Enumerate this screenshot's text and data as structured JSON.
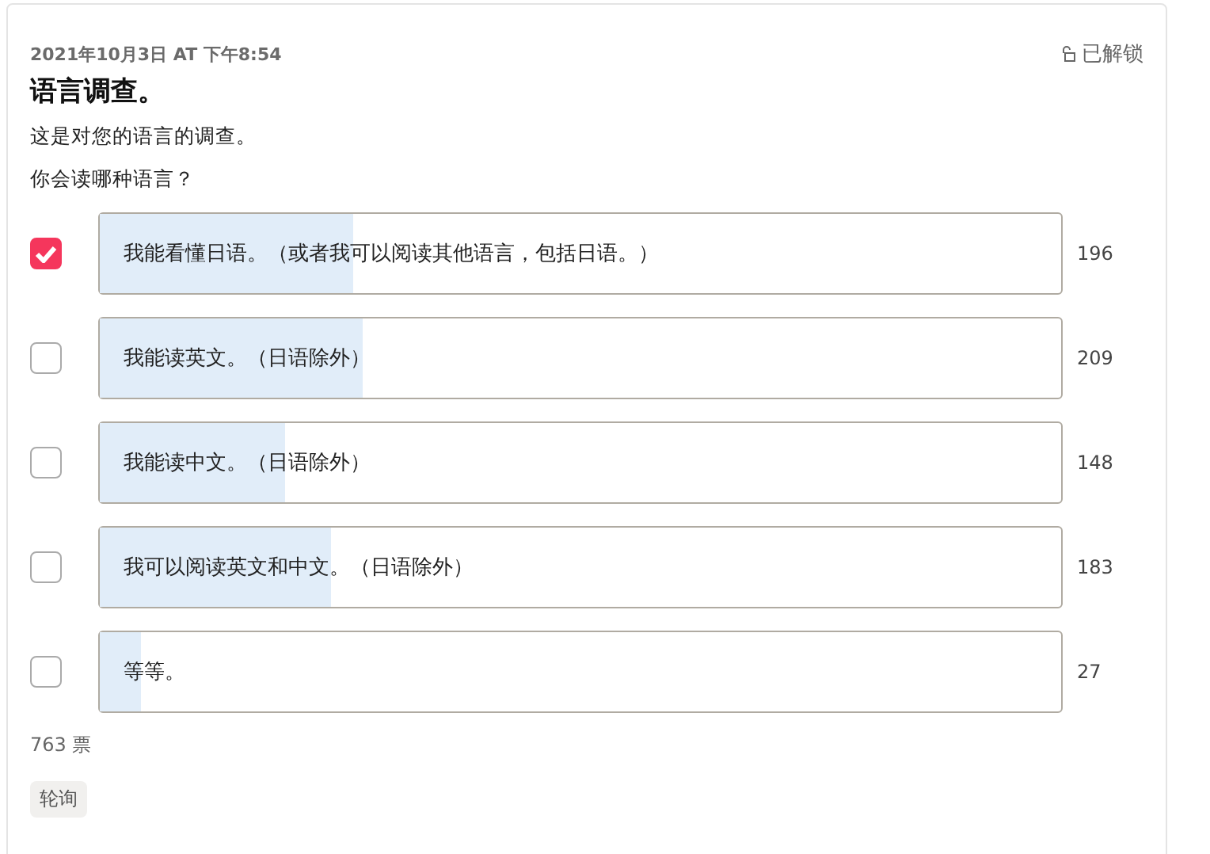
{
  "post": {
    "date": "2021年10月3日 AT 下午8:54",
    "title": "语言调查。",
    "lock": "已解锁",
    "description": "这是对您的语言的调查。",
    "question": "你会读哪种语言？"
  },
  "options": [
    {
      "label": "我能看懂日语。（或者我可以阅读其他语言，包括日语。）",
      "count": "196",
      "checked": true,
      "level": 0.263
    },
    {
      "label": "我能读英文。（日语除外）",
      "count": "209",
      "checked": false,
      "level": 0.273
    },
    {
      "label": "我能读中文。（日语除外）",
      "count": "148",
      "checked": false,
      "level": 0.192
    },
    {
      "label": "我可以阅读英文和中文。（日语除外）",
      "count": "183",
      "checked": false,
      "level": 0.241
    },
    {
      "label": "等等。",
      "count": "27",
      "checked": false,
      "level": 0.043
    }
  ],
  "total": "763 票",
  "tag": "轮询"
}
